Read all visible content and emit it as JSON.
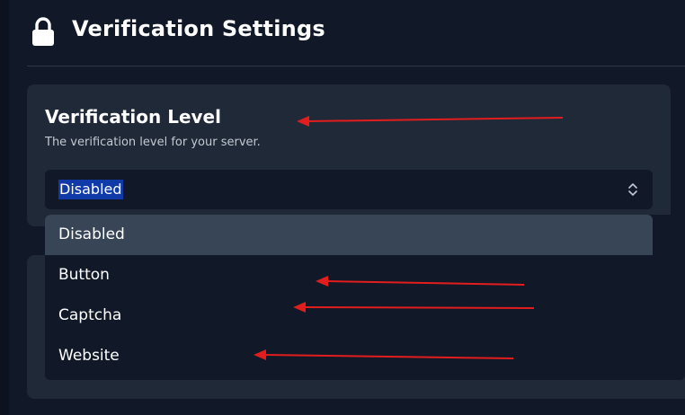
{
  "header": {
    "title": "Verification Settings",
    "icon": "lock-icon"
  },
  "card": {
    "title": "Verification Level",
    "description": "The verification level for your server.",
    "select": {
      "value": "Disabled",
      "icon": "chevron-up-down-icon"
    }
  },
  "dropdown": {
    "options": [
      {
        "label": "Disabled",
        "selected": true
      },
      {
        "label": "Button",
        "selected": false
      },
      {
        "label": "Captcha",
        "selected": false
      },
      {
        "label": "Website",
        "selected": false
      }
    ]
  },
  "colors": {
    "background": "#111827",
    "card": "#1f2937",
    "option_highlight": "#374557",
    "text_selection": "#0f3aa8",
    "annotation_arrow": "#e11d1d"
  }
}
